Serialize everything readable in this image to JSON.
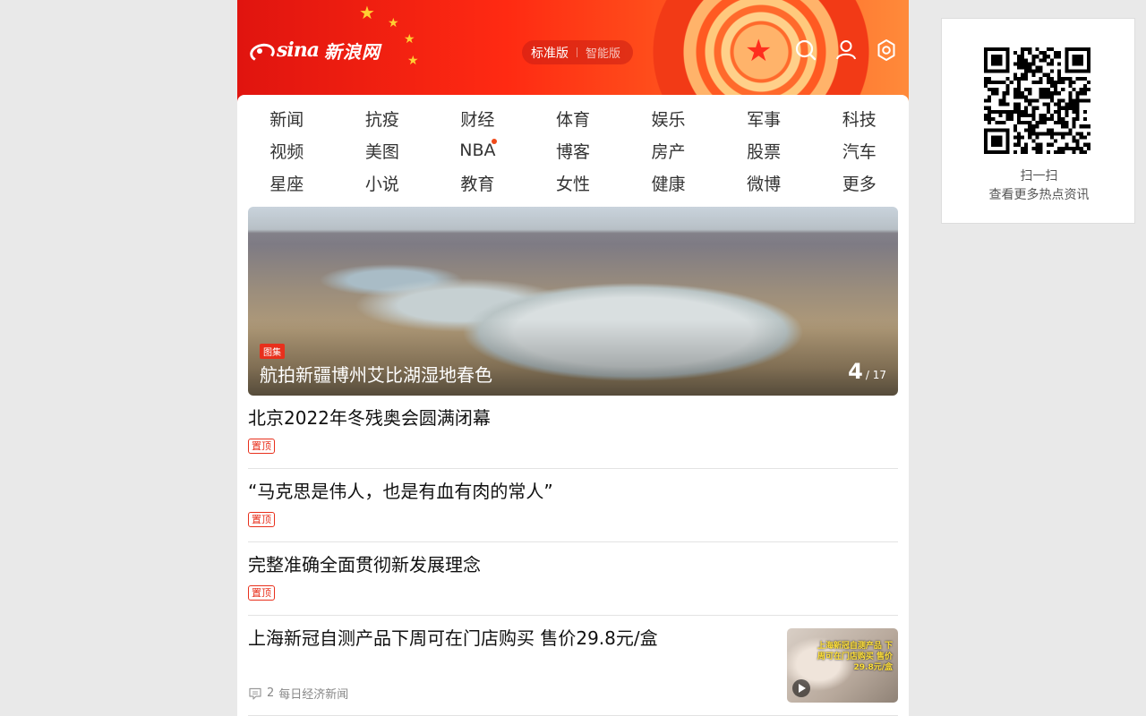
{
  "header": {
    "logo_text": "sina",
    "logo_cn": "新浪网",
    "mode_active": "标准版",
    "mode_other": "智能版"
  },
  "nav": {
    "items": [
      {
        "label": "新闻"
      },
      {
        "label": "抗疫"
      },
      {
        "label": "财经"
      },
      {
        "label": "体育"
      },
      {
        "label": "娱乐"
      },
      {
        "label": "军事"
      },
      {
        "label": "科技"
      },
      {
        "label": "视频"
      },
      {
        "label": "美图"
      },
      {
        "label": "NBA",
        "dot": true
      },
      {
        "label": "博客"
      },
      {
        "label": "房产"
      },
      {
        "label": "股票"
      },
      {
        "label": "汽车"
      },
      {
        "label": "星座"
      },
      {
        "label": "小说"
      },
      {
        "label": "教育"
      },
      {
        "label": "女性"
      },
      {
        "label": "健康"
      },
      {
        "label": "微博"
      },
      {
        "label": "更多"
      }
    ]
  },
  "hero": {
    "badge": "图集",
    "title": "航拍新疆博州艾比湖湿地春色",
    "current": "4",
    "total": "/ 17"
  },
  "feed": [
    {
      "title": "北京2022年冬残奥会圆满闭幕",
      "tag": "置顶"
    },
    {
      "title": "“马克思是伟人，也是有血有肉的常人”",
      "tag": "置顶"
    },
    {
      "title": "完整准确全面贯彻新发展理念",
      "tag": "置顶"
    },
    {
      "title": "上海新冠自测产品下周可在门店购买 售价29.8元/盒",
      "comments": "2",
      "source": "每日经济新闻",
      "thumb_caption": "上海新冠自测产品 下周可在门店购买 售价29.8元/盒"
    }
  ],
  "qr_panel": {
    "line1": "扫一扫",
    "line2": "查看更多热点资讯"
  },
  "colors": {
    "accent_red": "#e8301c",
    "header_red": "#ff2a12",
    "nav_dot": "#f04a1a"
  },
  "icons": {
    "search": "search-icon",
    "user": "user-icon",
    "settings": "gear-icon",
    "comment": "comment-icon",
    "play": "play-icon"
  }
}
